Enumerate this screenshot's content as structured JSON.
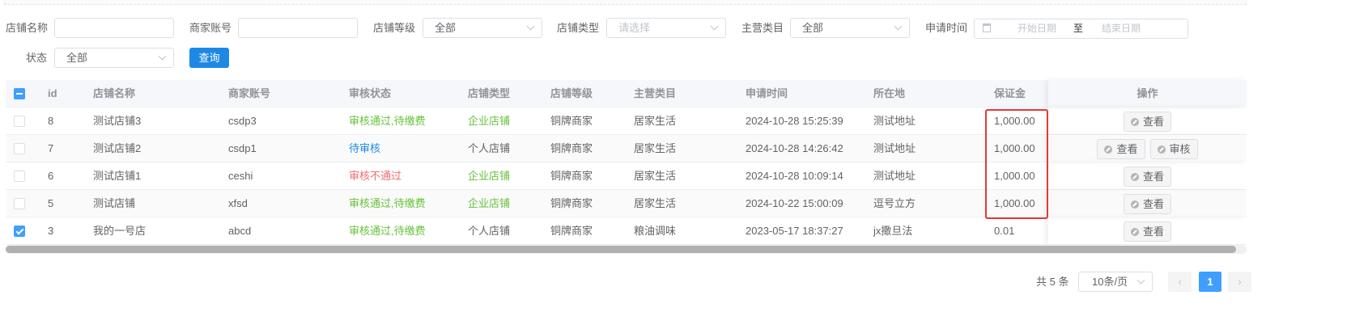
{
  "filters": {
    "shop_name": {
      "label": "店铺名称",
      "value": ""
    },
    "merchant_account": {
      "label": "商家账号",
      "value": ""
    },
    "shop_level": {
      "label": "店铺等级",
      "value": "全部"
    },
    "shop_type": {
      "label": "店铺类型",
      "placeholder": "请选择"
    },
    "main_category": {
      "label": "主营类目",
      "value": "全部"
    },
    "apply_time": {
      "label": "申请时间",
      "start_placeholder": "开始日期",
      "separator": "至",
      "end_placeholder": "结束日期"
    },
    "status": {
      "label": "状态",
      "value": "全部"
    },
    "query_label": "查询"
  },
  "table": {
    "headers": [
      "id",
      "店铺名称",
      "商家账号",
      "审核状态",
      "店铺类型",
      "店铺等级",
      "主营类目",
      "申请时间",
      "所在地",
      "保证金",
      "操作"
    ],
    "rows": [
      {
        "checked": false,
        "id": "8",
        "name": "测试店铺3",
        "account": "csdp3",
        "status": "审核通过,待缴费",
        "status_color": "green",
        "type": "企业店铺",
        "type_color": "green",
        "level": "铜牌商家",
        "category": "居家生活",
        "time": "2024-10-28 15:25:39",
        "location": "测试地址",
        "deposit": "1,000.00",
        "actions": [
          "查看"
        ]
      },
      {
        "checked": false,
        "id": "7",
        "name": "测试店铺2",
        "account": "csdp1",
        "status": "待审核",
        "status_color": "blue",
        "type": "个人店铺",
        "type_color": "",
        "level": "铜牌商家",
        "category": "居家生活",
        "time": "2024-10-28 14:26:42",
        "location": "测试地址",
        "deposit": "1,000.00",
        "actions": [
          "查看",
          "审核"
        ]
      },
      {
        "checked": false,
        "id": "6",
        "name": "测试店铺1",
        "account": "ceshi",
        "status": "审核不通过",
        "status_color": "red",
        "type": "企业店铺",
        "type_color": "green",
        "level": "铜牌商家",
        "category": "居家生活",
        "time": "2024-10-28 10:09:14",
        "location": "测试地址",
        "deposit": "1,000.00",
        "actions": [
          "查看"
        ]
      },
      {
        "checked": false,
        "id": "5",
        "name": "测试店铺",
        "account": "xfsd",
        "status": "审核通过,待缴费",
        "status_color": "green",
        "type": "企业店铺",
        "type_color": "green",
        "level": "铜牌商家",
        "category": "居家生活",
        "time": "2024-10-22 15:00:09",
        "location": "逗号立方",
        "deposit": "1,000.00",
        "actions": [
          "查看"
        ]
      },
      {
        "checked": true,
        "id": "3",
        "name": "我的一号店",
        "account": "abcd",
        "status": "审核通过,待缴费",
        "status_color": "green",
        "type": "个人店铺",
        "type_color": "",
        "level": "铜牌商家",
        "category": "粮油调味",
        "time": "2023-05-17 18:37:27",
        "location": "jx撒旦法",
        "deposit": "0.01",
        "actions": [
          "查看"
        ]
      }
    ]
  },
  "pagination": {
    "total": "共 5 条",
    "page_size": "10条/页",
    "current_page": "1"
  }
}
